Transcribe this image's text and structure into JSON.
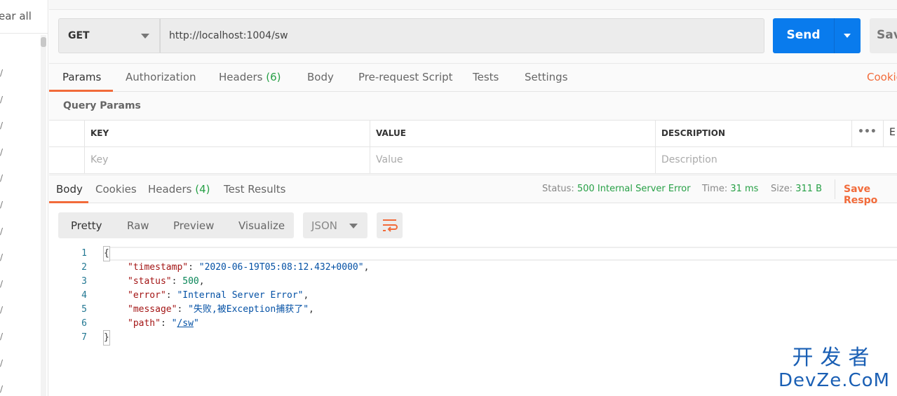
{
  "sidebar": {
    "clear_all": "ear all",
    "item_glyph": "/"
  },
  "request": {
    "method": "GET",
    "url": "http://localhost:1004/sw",
    "send": "Send",
    "save": "Sav"
  },
  "tabs": [
    {
      "label": "Params"
    },
    {
      "label": "Authorization"
    },
    {
      "label": "Headers",
      "count": "(6)"
    },
    {
      "label": "Body"
    },
    {
      "label": "Pre-request Script"
    },
    {
      "label": "Tests"
    },
    {
      "label": "Settings"
    }
  ],
  "cookies_link": "Cookie",
  "query_params": {
    "title": "Query Params",
    "columns": [
      "KEY",
      "VALUE",
      "DESCRIPTION"
    ],
    "placeholders": [
      "Key",
      "Value",
      "Description"
    ],
    "more": "•••",
    "bulk_edit": "E"
  },
  "response": {
    "tabs": [
      {
        "label": "Body"
      },
      {
        "label": "Cookies"
      },
      {
        "label": "Headers",
        "count": "(4)"
      },
      {
        "label": "Test Results"
      }
    ],
    "status_label": "Status:",
    "status": "500 Internal Server Error",
    "time_label": "Time:",
    "time": "31 ms",
    "size_label": "Size:",
    "size": "311 B",
    "save_response": "Save Respo",
    "views": [
      "Pretty",
      "Raw",
      "Preview",
      "Visualize"
    ],
    "format": "JSON"
  },
  "code": {
    "lines": [
      "1",
      "2",
      "3",
      "4",
      "5",
      "6",
      "7"
    ],
    "timestamp_key": "\"timestamp\"",
    "timestamp": "\"2020-06-19T05:08:12.432+0000\"",
    "status_key": "\"status\"",
    "status": "500",
    "error_key": "\"error\"",
    "error": "\"Internal Server Error\"",
    "message_key": "\"message\"",
    "message": "\"失败,被Exception捕获了\"",
    "path_key": "\"path\"",
    "path": "/sw"
  },
  "watermark": {
    "cn": "开发者",
    "en": "DevZe.CoM"
  },
  "colors": {
    "accent": "#f26b3a",
    "send": "#097bed",
    "success": "#27a046"
  }
}
